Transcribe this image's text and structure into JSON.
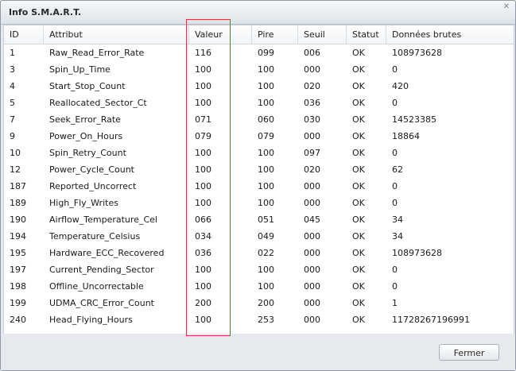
{
  "window": {
    "title": "Info S.M.A.R.T.",
    "close_glyph": "✕"
  },
  "table": {
    "columns": [
      "ID",
      "Attribut",
      "Valeur",
      "Pire",
      "Seuil",
      "Statut",
      "Données brutes"
    ],
    "rows": [
      [
        "1",
        "Raw_Read_Error_Rate",
        "116",
        "099",
        "006",
        "OK",
        "108973628"
      ],
      [
        "3",
        "Spin_Up_Time",
        "100",
        "100",
        "000",
        "OK",
        "0"
      ],
      [
        "4",
        "Start_Stop_Count",
        "100",
        "100",
        "020",
        "OK",
        "420"
      ],
      [
        "5",
        "Reallocated_Sector_Ct",
        "100",
        "100",
        "036",
        "OK",
        "0"
      ],
      [
        "7",
        "Seek_Error_Rate",
        "071",
        "060",
        "030",
        "OK",
        "14523385"
      ],
      [
        "9",
        "Power_On_Hours",
        "079",
        "079",
        "000",
        "OK",
        "18864"
      ],
      [
        "10",
        "Spin_Retry_Count",
        "100",
        "100",
        "097",
        "OK",
        "0"
      ],
      [
        "12",
        "Power_Cycle_Count",
        "100",
        "100",
        "020",
        "OK",
        "62"
      ],
      [
        "187",
        "Reported_Uncorrect",
        "100",
        "100",
        "000",
        "OK",
        "0"
      ],
      [
        "189",
        "High_Fly_Writes",
        "100",
        "100",
        "000",
        "OK",
        "0"
      ],
      [
        "190",
        "Airflow_Temperature_Cel",
        "066",
        "051",
        "045",
        "OK",
        "34"
      ],
      [
        "194",
        "Temperature_Celsius",
        "034",
        "049",
        "000",
        "OK",
        "34"
      ],
      [
        "195",
        "Hardware_ECC_Recovered",
        "036",
        "022",
        "000",
        "OK",
        "108973628"
      ],
      [
        "197",
        "Current_Pending_Sector",
        "100",
        "100",
        "000",
        "OK",
        "0"
      ],
      [
        "198",
        "Offline_Uncorrectable",
        "100",
        "100",
        "000",
        "OK",
        "0"
      ],
      [
        "199",
        "UDMA_CRC_Error_Count",
        "200",
        "200",
        "000",
        "OK",
        "1"
      ],
      [
        "240",
        "Head_Flying_Hours",
        "100",
        "253",
        "000",
        "OK",
        "11728267196991"
      ]
    ]
  },
  "footer": {
    "close_button": "Fermer"
  },
  "colors": {
    "highlight_border": "#d93a3a"
  }
}
